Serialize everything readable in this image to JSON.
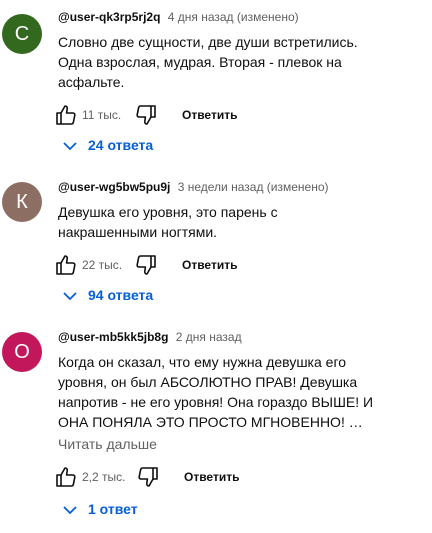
{
  "comments": [
    {
      "avatar_letter": "С",
      "avatar_color": "#33691e",
      "author": "@user-qk3rp5rj2q",
      "meta": "4 дня назад (изменено)",
      "text_lines": [
        "Словно две сущности, две души встретились.",
        "Одна взрослая, мудрая. Вторая - плевок на",
        "асфальте."
      ],
      "likes": "11 тыс.",
      "reply_label": "Ответить",
      "replies_label": "24 ответа"
    },
    {
      "avatar_letter": "К",
      "avatar_color": "#8d6e63",
      "author": "@user-wg5bw5pu9j",
      "meta": "3 недели назад (изменено)",
      "text_lines": [
        "Девушка его уровня, это парень с",
        "накрашенными ногтями."
      ],
      "likes": "22 тыс.",
      "reply_label": "Ответить",
      "replies_label": "94 ответа"
    },
    {
      "avatar_letter": "О",
      "avatar_color": "#c2185b",
      "author": "@user-mb5kk5jb8g",
      "meta": "2 дня назад",
      "text_lines": [
        "Когда он сказал, что ему нужна девушка его",
        "уровня, он был АБСОЛЮТНО ПРАВ! Девушка",
        "напротив - не его уровня! Она гораздо ВЫШЕ! И",
        "ОНА ПОНЯЛА ЭТО ПРОСТО МГНОВЕННО! …"
      ],
      "read_more": "Читать дальше",
      "likes": "2,2 тыс.",
      "reply_label": "Ответить",
      "replies_label": "1 ответ"
    }
  ],
  "icons": {
    "like": "thumb-up-outline",
    "dislike": "thumb-down-outline",
    "expand": "chevron-down"
  },
  "colors": {
    "link_blue": "#065fd4",
    "secondary_text": "#606060"
  }
}
